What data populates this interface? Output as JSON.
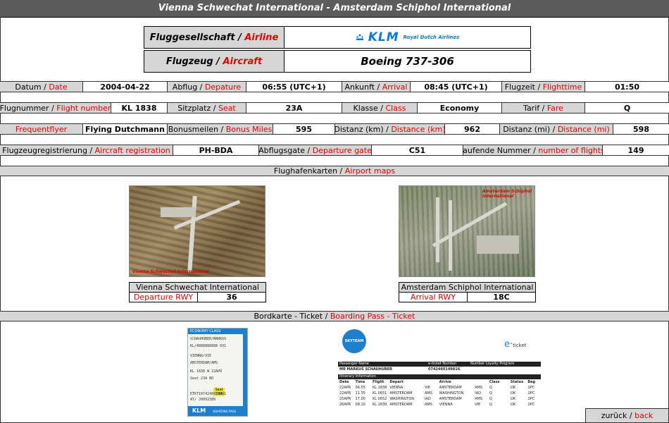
{
  "title": "Vienna Schwechat International - Amsterdam Schiphol International",
  "airline": {
    "label_de": "Fluggesellschaft",
    "label_en": "Airline",
    "logo_text": "KLM",
    "logo_sub": "Royal Dutch Airlines"
  },
  "aircraft": {
    "label_de": "Flugzeug",
    "label_en": "Aircraft",
    "value": "Boeing 737-306"
  },
  "rows": [
    [
      {
        "de": "Datum",
        "en": "Date",
        "value": "2004-04-22"
      },
      {
        "de": "Abflug",
        "en": "Depature",
        "value": "06:55 (UTC+1)"
      },
      {
        "de": "Ankunft",
        "en": "Arrival",
        "value": "08:45 (UTC+1)"
      },
      {
        "de": "Flugzeit",
        "en": "Flighttime",
        "value": "01:50"
      }
    ],
    [
      {
        "de": "Flugnummer",
        "en": "Flight number",
        "value": "KL 1838"
      },
      {
        "de": "Sitzplatz",
        "en": "Seat",
        "value": "23A"
      },
      {
        "de": "Klasse",
        "en": "Class",
        "value": "Economy"
      },
      {
        "de": "Tarif",
        "en": "Fare",
        "value": "Q"
      }
    ],
    [
      {
        "de": "",
        "en": "Frequentflyer",
        "value": "Flying Dutchmann"
      },
      {
        "de": "Bonusmeilen",
        "en": "Bonus Miles",
        "value": "595"
      },
      {
        "de": "Distanz (km)",
        "en": "Distance (km)",
        "value": "962"
      },
      {
        "de": "Distanz (mi)",
        "en": "Distance (mi)",
        "value": "598"
      }
    ],
    [
      {
        "de": "Flugzeugregistrierung",
        "en": "Aircraft registration",
        "value": "PH-BDA"
      },
      {
        "de": "Abflugsgate",
        "en": "Departure gate",
        "value": "C51"
      },
      {
        "de": "laufende Nummer",
        "en": "number of flights",
        "value": "149"
      }
    ]
  ],
  "maps_section": {
    "de": "Flughafenkarten",
    "en": "Airport maps"
  },
  "departure_airport": {
    "name": "Vienna Schwechat International",
    "rwy_label": "Departure RWY",
    "rwy": "36",
    "map_caption": "Vienna Schwechat International"
  },
  "arrival_airport": {
    "name": "Amsterdam Schiphol International",
    "rwy_label": "Arrival RWY",
    "rwy": "18C",
    "map_caption": "Amsterdam Schiphol International"
  },
  "boarding_section": {
    "de": "Bordkarte - Ticket",
    "en": "Boarding Pass - Ticket"
  },
  "boarding_pass": {
    "class": "ECONOMY CLASS",
    "lines": [
      "SCHAUHUBER/MARKUS",
      "KL/4888888888   031",
      "VIENNA/VIE",
      "AMSTERDAM/AMS",
      "KL 1838 W  22APR",
      "Seat 23A      NO",
      "ETKT1074246014981",
      "AT/ J0052389"
    ],
    "seat_label": "Seat",
    "seat": "23A",
    "footer": "KLM",
    "footer_sub": "BOARDING PASS"
  },
  "eticket": {
    "badge": "SKYTEAM",
    "logo": "e",
    "logo_sub": "ticket",
    "header": [
      "Passenger Name",
      "e-ticket Number",
      "Number Loyalty Program"
    ],
    "passenger": [
      "MR MARKUS SCHAUHUBER",
      "0742460149816"
    ],
    "itinerary_title": "Itinerary Information",
    "columns": [
      "Date",
      "Time",
      "Flight",
      "Depart",
      "",
      "Arrive",
      "",
      "Class",
      "Status",
      "Bag"
    ],
    "legs": [
      [
        "22APR",
        "06.55",
        "KL 1838",
        "VIENNA",
        "VIE",
        "AMSTERDAM",
        "AMS",
        "Q",
        "OK",
        "2PC"
      ],
      [
        "22APR",
        "11.35",
        "KL 0651",
        "AMSTERDAM",
        "AMS",
        "WASHINGTON",
        "IAD",
        "Q",
        "OK",
        "2PC"
      ],
      [
        "25APR",
        "17.00",
        "KL 0652",
        "WASHINGTON",
        "IAD",
        "AMSTERDAM",
        "AMS",
        "Q",
        "OK",
        "2PC"
      ],
      [
        "26APR",
        "08.10",
        "KL 1839",
        "AMSTERDAM",
        "AMS",
        "VIENNA",
        "VIE",
        "Q",
        "OK",
        "2PC"
      ]
    ]
  },
  "back": {
    "de": "zurück",
    "en": "back"
  }
}
